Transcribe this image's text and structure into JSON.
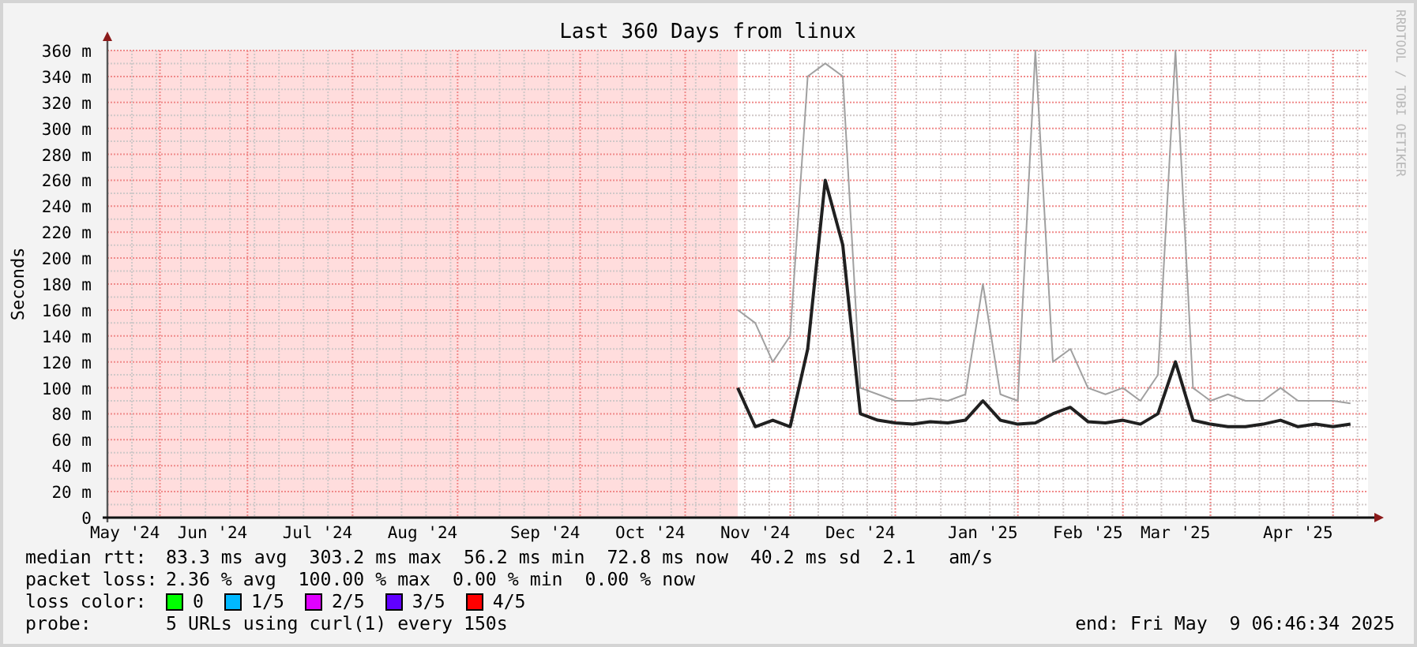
{
  "graph": {
    "title": "Last 360 Days from linux",
    "credit": "RRDTOOL / TOBI OETIKER",
    "chart_data": {
      "type": "line",
      "grid": true,
      "ylabel": "Seconds",
      "ylim": [
        0,
        360
      ],
      "categories": [
        null,
        "May '24",
        null,
        null,
        null,
        null,
        "Jun '24",
        null,
        null,
        null,
        null,
        null,
        "Jul '24",
        null,
        null,
        null,
        null,
        null,
        "Aug '24",
        null,
        null,
        null,
        null,
        null,
        null,
        "Sep '24",
        null,
        null,
        null,
        null,
        null,
        "Oct '24",
        null,
        null,
        null,
        null,
        null,
        "Nov '24",
        null,
        null,
        null,
        null,
        null,
        "Dec '24",
        null,
        null,
        null,
        null,
        null,
        null,
        "Jan '25",
        null,
        null,
        null,
        null,
        null,
        "Feb '25",
        null,
        null,
        null,
        null,
        "Mar '25",
        null,
        null,
        null,
        null,
        null,
        null,
        "Apr '25",
        null,
        null,
        null
      ],
      "series": [
        {
          "color": "#a0a0a0",
          "values": [
            null,
            null,
            null,
            null,
            null,
            null,
            null,
            null,
            null,
            null,
            null,
            null,
            null,
            null,
            null,
            null,
            null,
            null,
            null,
            null,
            null,
            null,
            null,
            null,
            null,
            null,
            null,
            null,
            null,
            null,
            null,
            null,
            null,
            null,
            null,
            null,
            160,
            150,
            120,
            140,
            340,
            350,
            340,
            100,
            95,
            90,
            90,
            92,
            90,
            95,
            180,
            95,
            90,
            360,
            120,
            130,
            100,
            95,
            100,
            90,
            110,
            360,
            100,
            90,
            95,
            90,
            90,
            100,
            90,
            90,
            90,
            88
          ]
        },
        {
          "color": "#202020",
          "values": [
            null,
            null,
            null,
            null,
            null,
            null,
            null,
            null,
            null,
            null,
            null,
            null,
            null,
            null,
            null,
            null,
            null,
            null,
            null,
            null,
            null,
            null,
            null,
            null,
            null,
            null,
            null,
            null,
            null,
            null,
            null,
            null,
            null,
            null,
            null,
            null,
            100,
            70,
            75,
            70,
            130,
            260,
            210,
            80,
            75,
            73,
            72,
            74,
            73,
            75,
            90,
            75,
            72,
            73,
            80,
            85,
            74,
            73,
            75,
            72,
            80,
            120,
            75,
            72,
            70,
            70,
            72,
            75,
            70,
            72,
            70,
            72
          ]
        }
      ],
      "yticks": [
        {
          "value": 0,
          "label": "0"
        },
        {
          "value": 20,
          "label": "20 m"
        },
        {
          "value": 40,
          "label": "40 m"
        },
        {
          "value": 60,
          "label": "60 m"
        },
        {
          "value": 80,
          "label": "80 m"
        },
        {
          "value": 100,
          "label": "100 m"
        },
        {
          "value": 120,
          "label": "120 m"
        },
        {
          "value": 140,
          "label": "140 m"
        },
        {
          "value": 160,
          "label": "160 m"
        },
        {
          "value": 180,
          "label": "180 m"
        },
        {
          "value": 200,
          "label": "200 m"
        },
        {
          "value": 220,
          "label": "220 m"
        },
        {
          "value": 240,
          "label": "240 m"
        },
        {
          "value": 260,
          "label": "260 m"
        },
        {
          "value": 280,
          "label": "280 m"
        },
        {
          "value": 300,
          "label": "300 m"
        },
        {
          "value": 320,
          "label": "320 m"
        },
        {
          "value": 340,
          "label": "340 m"
        },
        {
          "value": 360,
          "label": "360 m"
        }
      ]
    }
  },
  "legend": {
    "median_rtt": {
      "label": "median rtt:",
      "text": "83.3 ms avg  303.2 ms max  56.2 ms min  72.8 ms now  40.2 ms sd  2.1   am/s"
    },
    "packet_loss": {
      "label": "packet loss:",
      "text": "2.36 % avg  100.00 % max  0.00 % min  0.00 % now"
    },
    "loss_color": {
      "label": "loss color:",
      "items": [
        {
          "label": "0",
          "color": "#00ff00"
        },
        {
          "label": "1/5",
          "color": "#00b8ff"
        },
        {
          "label": "2/5",
          "color": "#e000ff"
        },
        {
          "label": "3/5",
          "color": "#6000ff"
        },
        {
          "label": "4/5",
          "color": "#ff0000"
        }
      ]
    },
    "probe": {
      "label": "probe:",
      "text": "5 URLs using curl(1) every 150s"
    },
    "end": "end: Fri May  9 06:46:34 2025"
  }
}
